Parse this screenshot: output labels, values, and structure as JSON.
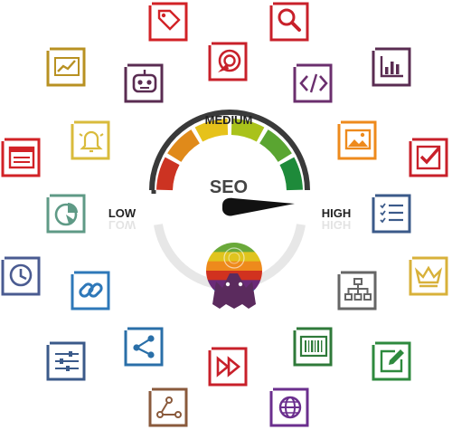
{
  "gauge": {
    "label_low": "LOW",
    "label_medium": "MEDIUM",
    "label_high": "HIGH",
    "center_label": "SEO",
    "level": "high",
    "segment_colors": [
      "#cc3322",
      "#e08a1a",
      "#e6c21a",
      "#a9c21b",
      "#5aa531",
      "#1e8a3a"
    ],
    "frame_color": "#3a3a3a",
    "needle_color": "#111111"
  },
  "logo": {
    "stripe_colors": [
      "#6aa93a",
      "#e0c41e",
      "#ee8a1c",
      "#d1321f",
      "#6a2a78",
      "#2e78b9"
    ],
    "mascot_color": "#5b2b5e"
  },
  "icons": [
    {
      "name": "tag-icon",
      "color": "#d22226"
    },
    {
      "name": "search-icon",
      "color": "#c8202a"
    },
    {
      "name": "trend-chart-icon",
      "color": "#b89122"
    },
    {
      "name": "robot-icon",
      "color": "#5a2c52"
    },
    {
      "name": "target-click-icon",
      "color": "#c8202a"
    },
    {
      "name": "code-icon",
      "color": "#6b2f6e"
    },
    {
      "name": "bar-chart-icon",
      "color": "#5a2c52"
    },
    {
      "name": "bell-icon",
      "color": "#d9bb3c"
    },
    {
      "name": "image-icon",
      "color": "#ee8a1c"
    },
    {
      "name": "browser-window-icon",
      "color": "#d22226"
    },
    {
      "name": "checkbox-icon",
      "color": "#c8202a"
    },
    {
      "name": "pie-chart-icon",
      "color": "#5f9a86"
    },
    {
      "name": "checklist-icon",
      "color": "#3b5a8a"
    },
    {
      "name": "clock-icon",
      "color": "#4a5b91"
    },
    {
      "name": "link-icon",
      "color": "#2e78b9"
    },
    {
      "name": "sitemap-icon",
      "color": "#666666"
    },
    {
      "name": "crown-icon",
      "color": "#d8b13a"
    },
    {
      "name": "sliders-icon",
      "color": "#3b5a8a"
    },
    {
      "name": "share-icon",
      "color": "#2a6fa8"
    },
    {
      "name": "barcode-icon",
      "color": "#2f7a3a"
    },
    {
      "name": "edit-icon",
      "color": "#2e8a3e"
    },
    {
      "name": "fast-forward-icon",
      "color": "#c8202a"
    },
    {
      "name": "workflow-icon",
      "color": "#8a5a3c"
    },
    {
      "name": "globe-icon",
      "color": "#6b2f8e"
    }
  ]
}
